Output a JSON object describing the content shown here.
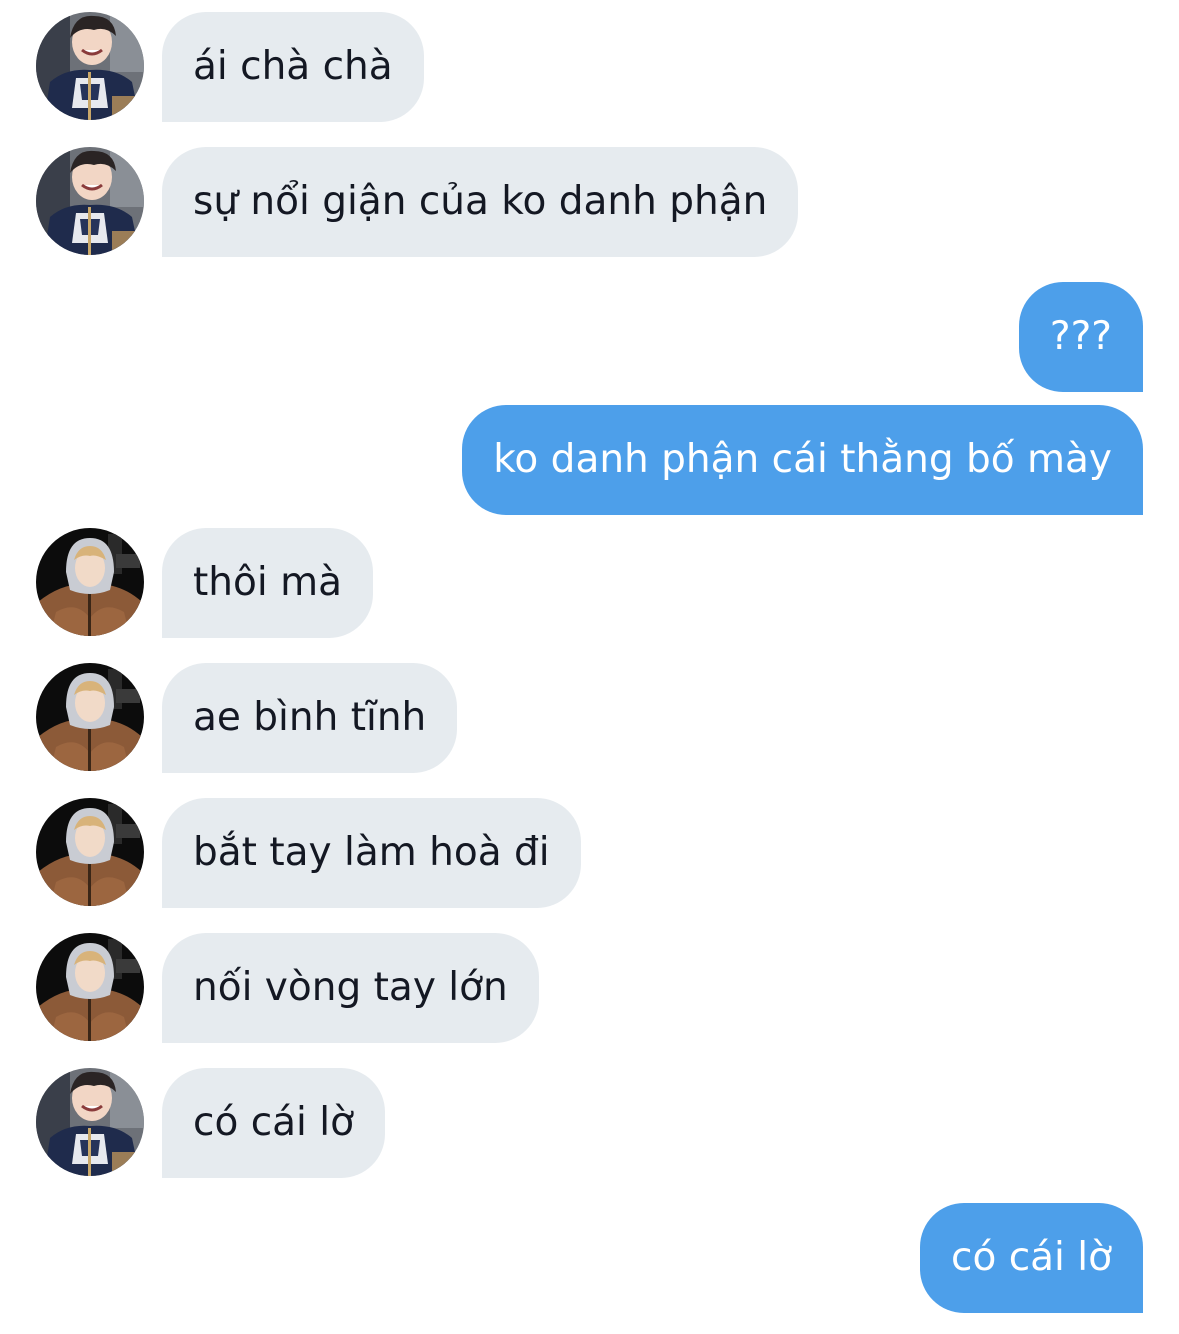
{
  "conversation": {
    "messages": [
      {
        "text": "ái chà chà",
        "direction": "incoming",
        "avatar": "avatar-navy-jacket"
      },
      {
        "text": "sự nổi giận của ko danh phận",
        "direction": "incoming",
        "avatar": "avatar-navy-jacket"
      },
      {
        "text": "???",
        "direction": "outgoing"
      },
      {
        "text": "ko danh phận cái thằng bố mày",
        "direction": "outgoing"
      },
      {
        "text": "thôi mà",
        "direction": "incoming",
        "avatar": "avatar-brown-hoodie"
      },
      {
        "text": "ae bình tĩnh",
        "direction": "incoming",
        "avatar": "avatar-brown-hoodie"
      },
      {
        "text": "bắt tay làm hoà đi",
        "direction": "incoming",
        "avatar": "avatar-brown-hoodie"
      },
      {
        "text": "nối vòng tay lớn",
        "direction": "incoming",
        "avatar": "avatar-brown-hoodie"
      },
      {
        "text": "có cái lờ",
        "direction": "incoming",
        "avatar": "avatar-navy-jacket"
      },
      {
        "text": "có cái lờ",
        "direction": "outgoing"
      }
    ]
  },
  "colors": {
    "incoming_bubble": "#e6ebef",
    "incoming_text": "#141823",
    "outgoing_bubble": "#4d9fea",
    "outgoing_text": "#ffffff"
  }
}
